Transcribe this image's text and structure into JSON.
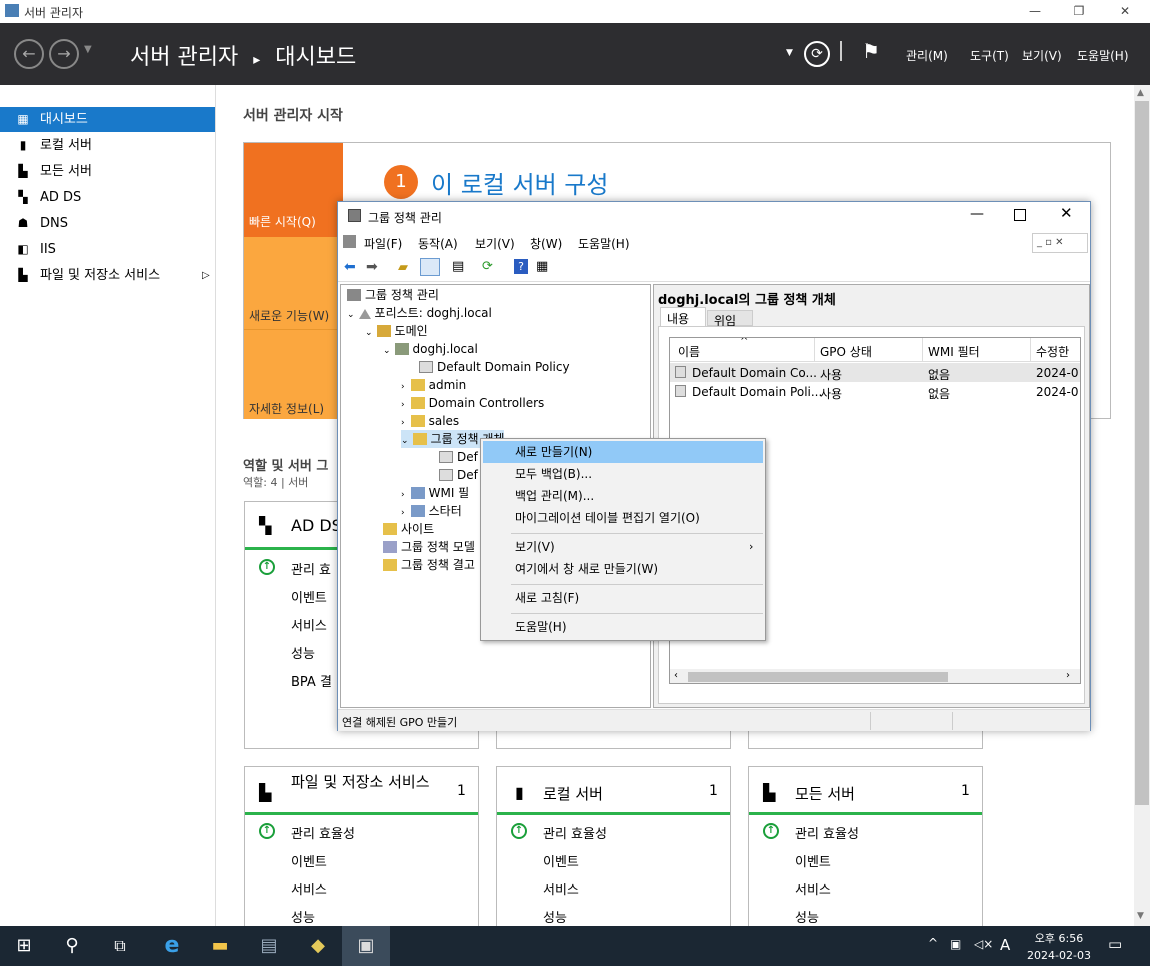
{
  "window": {
    "title": "서버 관리자",
    "min": "—",
    "max": "❐",
    "close": "✕"
  },
  "header": {
    "breadcrumb_app": "서버 관리자",
    "breadcrumb_sep": "▸",
    "breadcrumb_page": "대시보드",
    "menus": [
      "관리(M)",
      "도구(T)",
      "보기(V)",
      "도움말(H)"
    ]
  },
  "sidebar": {
    "items": [
      {
        "label": "대시보드",
        "icon": "dashboard-icon"
      },
      {
        "label": "로컬 서버",
        "icon": "server-icon"
      },
      {
        "label": "모든 서버",
        "icon": "servers-icon"
      },
      {
        "label": "AD DS",
        "icon": "adds-icon"
      },
      {
        "label": "DNS",
        "icon": "dns-icon"
      },
      {
        "label": "IIS",
        "icon": "iis-icon"
      },
      {
        "label": "파일 및 저장소 서비스",
        "icon": "storage-icon",
        "arrow": "▷"
      }
    ]
  },
  "welcome": {
    "title": "서버 관리자 시작",
    "quick": "빠른 시작(Q)",
    "new": "새로운 기능(W)",
    "more": "자세한 정보(L)",
    "step_num": "1",
    "step_text": "이 로컬 서버 구성"
  },
  "roles": {
    "title": "역할 및 서버 그",
    "summary": "역할: 4  |  서버"
  },
  "tiles": [
    {
      "name": "AD DS",
      "count": "",
      "lines": [
        "관리 효",
        "이벤트",
        "서비스",
        "성능",
        "BPA 결"
      ]
    },
    {
      "name": "파일 및 저장소 서비스",
      "count": "1",
      "lines": [
        "관리 효율성",
        "이벤트",
        "서비스",
        "성능"
      ]
    },
    {
      "name": "로컬 서버",
      "count": "1",
      "lines": [
        "관리 효율성",
        "이벤트",
        "서비스",
        "성능"
      ]
    },
    {
      "name": "모든 서버",
      "count": "1",
      "lines": [
        "관리 효율성",
        "이벤트",
        "서비스",
        "성능"
      ]
    }
  ],
  "gpm": {
    "title": "그룹 정책 관리",
    "menus": [
      "파일(F)",
      "동작(A)",
      "보기(V)",
      "창(W)",
      "도움말(H)"
    ],
    "tree": [
      "그룹 정책 관리",
      "포리스트: doghj.local",
      "도메인",
      "doghj.local",
      "Default Domain Policy",
      "admin",
      "Domain Controllers",
      "sales",
      "그룹 정책 개체",
      "Def",
      "Def",
      "WMI 필",
      "스타터",
      "사이트",
      "그룹 정책 모델",
      "그룹 정책 결고"
    ],
    "panel_title": "doghj.local의 그룹 정책 개체",
    "tabs": [
      "내용",
      "위임"
    ],
    "columns": [
      "이름",
      "GPO 상태",
      "WMI 필터",
      "수정한"
    ],
    "rows": [
      [
        "Default Domain Co...",
        "사용",
        "없음",
        "2024-0"
      ],
      [
        "Default Domain Poli...",
        "사용",
        "없음",
        "2024-0"
      ]
    ],
    "status": "연결 해제된 GPO 만들기"
  },
  "context_menu": [
    "새로 만들기(N)",
    "모두 백업(B)...",
    "백업 관리(M)...",
    "마이그레이션 테이블 편집기 열기(O)",
    "보기(V)",
    "여기에서 창 새로 만들기(W)",
    "새로 고침(F)",
    "도움말(H)"
  ],
  "taskbar": {
    "time": "오후 6:56",
    "date": "2024-02-03",
    "ime": "A"
  }
}
